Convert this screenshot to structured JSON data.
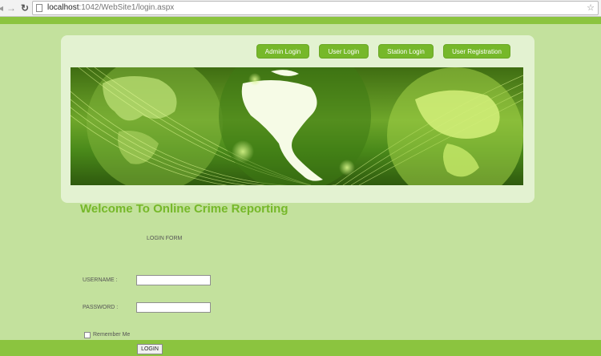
{
  "browser": {
    "back_icon": "back-arrow-icon",
    "forward_icon": "forward-arrow-icon",
    "reload_icon": "reload-icon",
    "url_host": "localhost",
    "url_rest": ":1042/WebSite1/login.aspx",
    "bookmark_icon": "star-icon"
  },
  "nav": {
    "admin": "Admin Login",
    "user": "User Login",
    "station": "Station Login",
    "registration": "User Registration"
  },
  "banner": {
    "image": "world-globe-banner"
  },
  "page": {
    "welcome": "Welcome To Online Crime Reporting",
    "form_title": "LOGIN FORM"
  },
  "form": {
    "username_label": "USERNAME :",
    "password_label": "PASSWORD :",
    "username_value": "",
    "password_value": "",
    "remember_label": "Remember Me",
    "remember_checked": false,
    "login_button": "LOGIN"
  },
  "colors": {
    "page_background": "#c3e19d",
    "accent_green": "#8bc43f",
    "button_green": "#76b82a",
    "header_box": "#e3f2d1"
  }
}
